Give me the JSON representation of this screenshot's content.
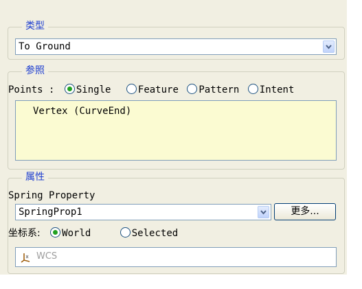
{
  "type_group": {
    "title": "类型",
    "selected": "To Ground"
  },
  "reference_group": {
    "title": "参照",
    "points_label": "Points :",
    "options": [
      "Single",
      "Feature",
      "Pattern",
      "Intent"
    ],
    "selected_option": "Single",
    "items": [
      "Vertex (CurveEnd)"
    ]
  },
  "property_group": {
    "title": "属性",
    "spring_property_label": "Spring Property",
    "spring_property_value": "SpringProp1",
    "more_button": "更多...",
    "csys_label": "坐标系:",
    "csys_options": [
      "World",
      "Selected"
    ],
    "csys_selected": "World",
    "csys_field_text": "WCS",
    "csys_icon": "coordinate-system-icon"
  },
  "colors": {
    "panel_bg": "#f1efe2",
    "group_title": "#1f3fd0",
    "listbox_bg": "#fbfbd2",
    "radio_dot": "#21a121"
  }
}
